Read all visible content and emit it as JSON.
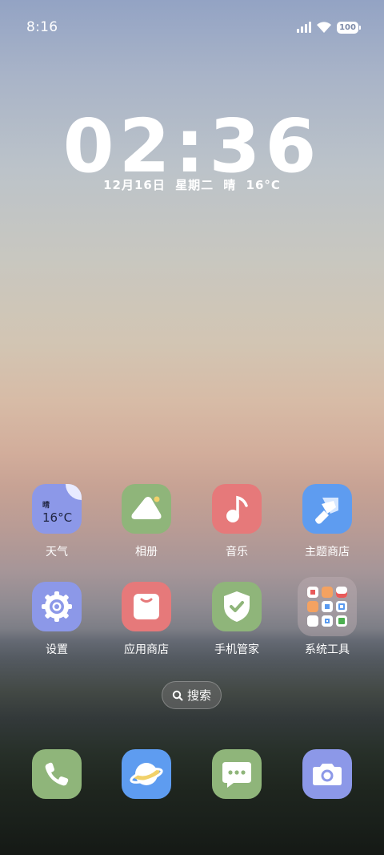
{
  "status_bar": {
    "time": "8:16",
    "battery": "100"
  },
  "lockscreen_clock": {
    "time": "02:36",
    "date_line": "12月16日 星期二 晴 16°C"
  },
  "weather_widget": {
    "condition": "晴",
    "temperature": "16°C"
  },
  "apps": [
    {
      "label": "天气",
      "icon": "weather-icon",
      "color": "#8c98e8"
    },
    {
      "label": "相册",
      "icon": "gallery-icon",
      "color": "#8fb57a"
    },
    {
      "label": "音乐",
      "icon": "music-icon",
      "color": "#e6797a"
    },
    {
      "label": "主题商店",
      "icon": "theme-store-icon",
      "color": "#5e9cf0"
    },
    {
      "label": "设置",
      "icon": "settings-icon",
      "color": "#8c98e8"
    },
    {
      "label": "应用商店",
      "icon": "app-store-icon",
      "color": "#e6797a"
    },
    {
      "label": "手机管家",
      "icon": "phone-manager-icon",
      "color": "#8fb57a"
    },
    {
      "label": "系统工具",
      "icon": "system-tools-folder-icon",
      "color": "#c4b3b8"
    }
  ],
  "search": {
    "label": "搜索"
  },
  "dock": [
    {
      "icon": "phone-icon",
      "color": "#8fb57a"
    },
    {
      "icon": "browser-icon",
      "color": "#5e9cf0"
    },
    {
      "icon": "messages-icon",
      "color": "#8fb57a"
    },
    {
      "icon": "camera-icon",
      "color": "#8c98e8"
    }
  ]
}
